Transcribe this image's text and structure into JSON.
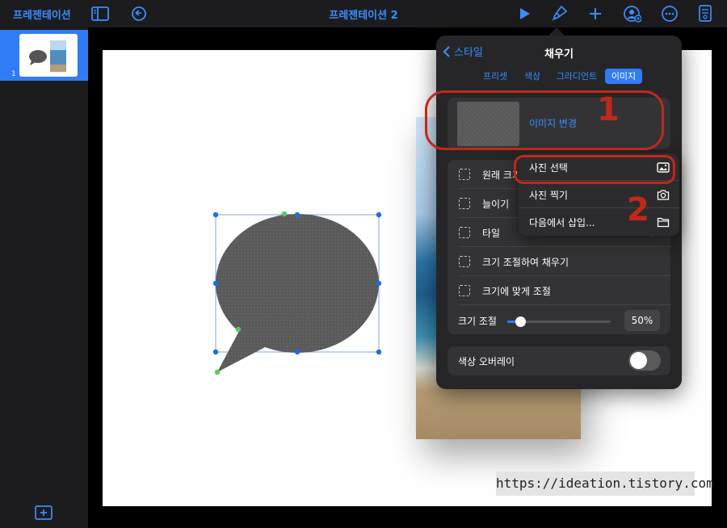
{
  "toolbar": {
    "app_title": "프레젠테이션",
    "doc_title": "프레젠테이션 2",
    "icons": [
      "sidebar-toggle-icon",
      "undo-icon",
      "play-icon",
      "paintbrush-icon",
      "plus-icon",
      "collaborate-icon",
      "more-icon",
      "document-icon"
    ]
  },
  "sidebar": {
    "slides": [
      {
        "number": "1"
      }
    ],
    "add_icon": "add-slide-icon"
  },
  "popover": {
    "back_label": "스타일",
    "title": "채우기",
    "tabs": [
      {
        "label": "프리셋",
        "active": false
      },
      {
        "label": "색상",
        "active": false
      },
      {
        "label": "그라디언트",
        "active": false
      },
      {
        "label": "이미지",
        "active": true
      }
    ],
    "change_image_label": "이미지 변경",
    "options": [
      {
        "label": "원래 크기"
      },
      {
        "label": "늘이기"
      },
      {
        "label": "타일"
      },
      {
        "label": "크기 조절하여 채우기"
      },
      {
        "label": "크기에 맞게 조절"
      }
    ],
    "scale_label": "크기 조절",
    "scale_value": "50%",
    "scale_fraction": 0.5,
    "overlay_label": "색상 오버레이",
    "overlay_on": false
  },
  "submenu": {
    "items": [
      {
        "label": "사진 선택",
        "icon": "photo-icon"
      },
      {
        "label": "사진 찍기",
        "icon": "camera-icon"
      },
      {
        "label": "다음에서 삽입...",
        "icon": "folder-icon"
      }
    ]
  },
  "annotations": {
    "num1": "1",
    "num2": "2",
    "color": "#c0281a"
  },
  "watermark": "https://ideation.tistory.com",
  "colors": {
    "accent": "#3a8dff",
    "active_tab": "#2f7cf6"
  }
}
